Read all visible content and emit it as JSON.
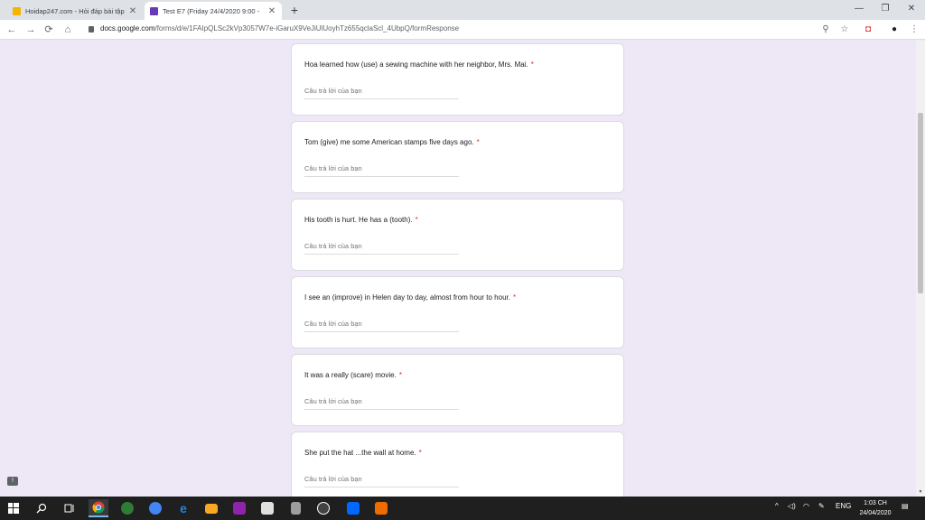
{
  "browser": {
    "tabs": [
      {
        "title": "Hoidap247.com - Hỏi đáp bài tập",
        "favicon_color": "#f4b400",
        "active": false
      },
      {
        "title": "Test E7 (Friday 24/4/2020 9:00 -",
        "favicon_color": "#673ab7",
        "active": true
      }
    ],
    "new_tab_label": "+",
    "url_host": "docs.google.com",
    "url_path": "/forms/d/e/1FAIpQLSc2kVp3057W7e-iGaruX9VeJiUlUoyhTz655qclaScl_4UbpQ/formResponse"
  },
  "icons": {
    "back": "←",
    "forward": "→",
    "reload": "⟳",
    "home": "⌂",
    "zoom": "⚲",
    "star": "☆",
    "extension": "◘",
    "profile": "●",
    "menu": "⋮",
    "minimize": "—",
    "maximize": "❐",
    "close": "✕",
    "tab_close": "✕",
    "feedback": "!"
  },
  "form": {
    "required_mark": "*",
    "answer_placeholder": "Câu trả lời của bạn",
    "questions": [
      {
        "text": "Hoa learned how (use) a sewing machine with her neighbor, Mrs. Mai."
      },
      {
        "text": "Tom (give) me some American stamps five days ago."
      },
      {
        "text": "His tooth is hurt. He has a (tooth)."
      },
      {
        "text": "I see an (improve) in Helen day to day, almost from hour to hour."
      },
      {
        "text": "It was a really (scare) movie."
      },
      {
        "text": "She put the hat ...the wall at home."
      }
    ]
  },
  "taskbar": {
    "apps": [
      {
        "name": "windows-start",
        "color": "#ffffff"
      },
      {
        "name": "search",
        "color": "#ffffff"
      },
      {
        "name": "task-view",
        "color": "#ffffff"
      },
      {
        "name": "chrome",
        "color": "#db4437"
      },
      {
        "name": "app-green",
        "color": "#2e7d32"
      },
      {
        "name": "chrome-blue",
        "color": "#4285f4"
      },
      {
        "name": "edge",
        "color": "#1e88e5"
      },
      {
        "name": "file-explorer",
        "color": "#f9a825"
      },
      {
        "name": "winrar",
        "color": "#8e24aa"
      },
      {
        "name": "app-puzzle",
        "color": "#e0e0e0"
      },
      {
        "name": "calculator",
        "color": "#9e9e9e"
      },
      {
        "name": "unreal",
        "color": "#424242"
      },
      {
        "name": "zalo",
        "color": "#0068ff"
      },
      {
        "name": "app-orange",
        "color": "#ef6c00"
      }
    ],
    "tray_language": "ENG",
    "time": "1:03 CH",
    "date": "24/04/2020"
  }
}
